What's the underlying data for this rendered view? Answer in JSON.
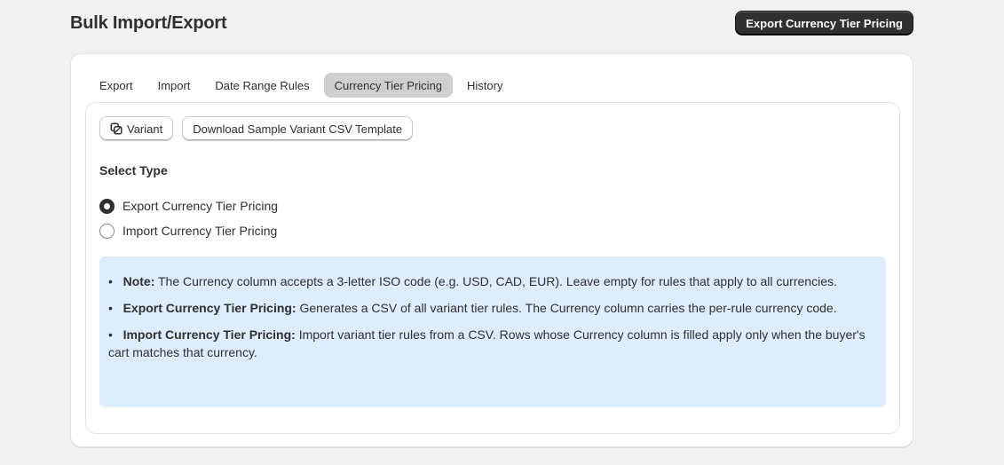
{
  "page": {
    "title": "Bulk Import/Export",
    "primary_action": "Export Currency Tier Pricing"
  },
  "tabs": [
    {
      "label": "Export",
      "active": false
    },
    {
      "label": "Import",
      "active": false
    },
    {
      "label": "Date Range Rules",
      "active": false
    },
    {
      "label": "Currency Tier Pricing",
      "active": true
    },
    {
      "label": "History",
      "active": false
    }
  ],
  "toolbar": {
    "variant_label": "Variant",
    "variant_icon": "variant-icon",
    "download_label": "Download Sample Variant CSV Template"
  },
  "select_type": {
    "title": "Select Type",
    "options": [
      {
        "label": "Export Currency Tier Pricing",
        "checked": true
      },
      {
        "label": "Import Currency Tier Pricing",
        "checked": false
      }
    ]
  },
  "notes": [
    {
      "heading": "Note:",
      "text": "The Currency column accepts a 3-letter ISO code (e.g. USD, CAD, EUR). Leave empty for rules that apply to all currencies."
    },
    {
      "heading": "Export Currency Tier Pricing:",
      "text": "Generates a CSV of all variant tier rules. The Currency column carries the per-rule currency code."
    },
    {
      "heading": "Import Currency Tier Pricing:",
      "text": "Import variant tier rules from a CSV. Rows whose Currency column is filled apply only when the buyer's cart matches that currency."
    }
  ],
  "colors": {
    "background": "#f1f1f1",
    "primary_button": "#303030",
    "active_tab": "#cfcfcf",
    "note_background": "#ddedfd"
  }
}
